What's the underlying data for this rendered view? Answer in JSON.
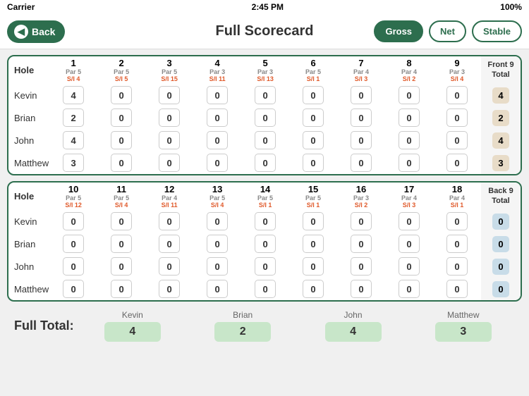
{
  "statusBar": {
    "carrier": "Carrier",
    "time": "2:45 PM",
    "battery": "100%"
  },
  "header": {
    "backLabel": "Back",
    "title": "Full Scorecard",
    "tabs": [
      "Gross",
      "Net",
      "Stable"
    ],
    "activeTab": "Gross"
  },
  "front9": {
    "sectionLabel": "Hole",
    "totalLabel": "Front 9\nTotal",
    "holes": [
      {
        "num": "1",
        "par": "Par 5",
        "si": "S/I 4"
      },
      {
        "num": "2",
        "par": "Par 5",
        "si": "S/I 5"
      },
      {
        "num": "3",
        "par": "Par 5",
        "si": "S/I 15"
      },
      {
        "num": "4",
        "par": "Par 3",
        "si": "S/I 11"
      },
      {
        "num": "5",
        "par": "Par 3",
        "si": "S/I 13"
      },
      {
        "num": "6",
        "par": "Par 5",
        "si": "S/I 1"
      },
      {
        "num": "7",
        "par": "Par 4",
        "si": "S/I 3"
      },
      {
        "num": "8",
        "par": "Par 4",
        "si": "S/I 2"
      },
      {
        "num": "9",
        "par": "Par 3",
        "si": "S/I 4"
      }
    ],
    "players": [
      {
        "name": "Kevin",
        "scores": [
          4,
          0,
          0,
          0,
          0,
          0,
          0,
          0,
          0
        ],
        "total": 4
      },
      {
        "name": "Brian",
        "scores": [
          2,
          0,
          0,
          0,
          0,
          0,
          0,
          0,
          0
        ],
        "total": 2
      },
      {
        "name": "John",
        "scores": [
          4,
          0,
          0,
          0,
          0,
          0,
          0,
          0,
          0
        ],
        "total": 4
      },
      {
        "name": "Matthew",
        "scores": [
          3,
          0,
          0,
          0,
          0,
          0,
          0,
          0,
          0
        ],
        "total": 3
      }
    ]
  },
  "back9": {
    "sectionLabel": "Hole",
    "totalLabel": "Back 9\nTotal",
    "holes": [
      {
        "num": "10",
        "par": "Par 5",
        "si": "S/I 12"
      },
      {
        "num": "11",
        "par": "Par 5",
        "si": "S/I 4"
      },
      {
        "num": "12",
        "par": "Par 4",
        "si": "S/I 11"
      },
      {
        "num": "13",
        "par": "Par 5",
        "si": "S/I 4"
      },
      {
        "num": "14",
        "par": "Par 5",
        "si": "S/I 1"
      },
      {
        "num": "15",
        "par": "Par 5",
        "si": "S/I 1"
      },
      {
        "num": "16",
        "par": "Par 3",
        "si": "S/I 2"
      },
      {
        "num": "17",
        "par": "Par 4",
        "si": "S/I 3"
      },
      {
        "num": "18",
        "par": "Par 4",
        "si": "S/I 1"
      }
    ],
    "players": [
      {
        "name": "Kevin",
        "scores": [
          0,
          0,
          0,
          0,
          0,
          0,
          0,
          0,
          0
        ],
        "total": 0
      },
      {
        "name": "Brian",
        "scores": [
          0,
          0,
          0,
          0,
          0,
          0,
          0,
          0,
          0
        ],
        "total": 0
      },
      {
        "name": "John",
        "scores": [
          0,
          0,
          0,
          0,
          0,
          0,
          0,
          0,
          0
        ],
        "total": 0
      },
      {
        "name": "Matthew",
        "scores": [
          0,
          0,
          0,
          0,
          0,
          0,
          0,
          0,
          0
        ],
        "total": 0
      }
    ]
  },
  "fullTotal": {
    "label": "Full Total:",
    "players": [
      {
        "name": "Kevin",
        "total": 4
      },
      {
        "name": "Brian",
        "total": 2
      },
      {
        "name": "John",
        "total": 4
      },
      {
        "name": "Matthew",
        "total": 3
      }
    ]
  }
}
